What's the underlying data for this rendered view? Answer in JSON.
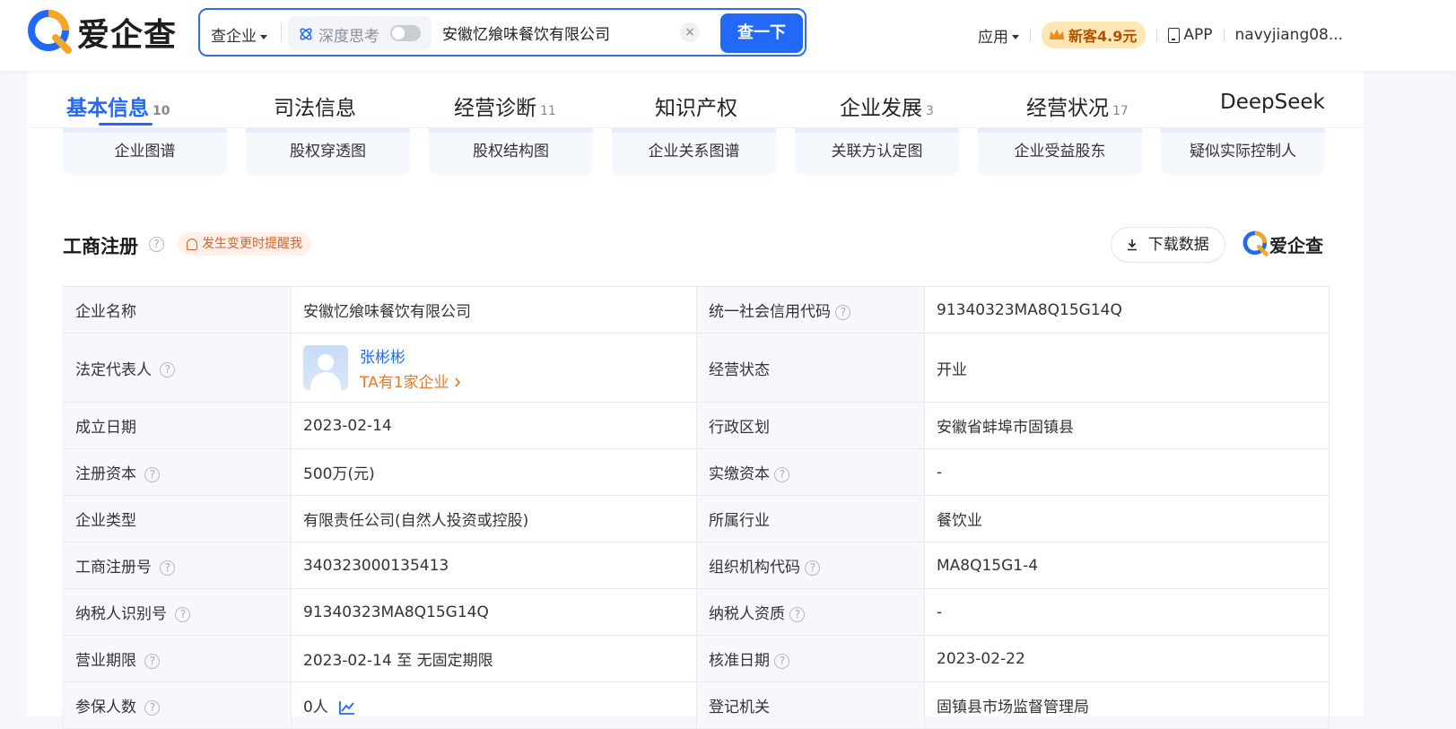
{
  "header": {
    "logo_text": "爱企查",
    "search_type": "查企业",
    "deep_think_label": "深度思考",
    "search_value": "安徽忆飨味餐饮有限公司",
    "clear_label": "×",
    "search_button": "查一下",
    "apps_label": "应用",
    "promo_label": "新客4.9元",
    "app_label": "APP",
    "username": "navyjiang08..."
  },
  "tabs": [
    {
      "label": "基本信息",
      "count": "10"
    },
    {
      "label": "司法信息",
      "count": ""
    },
    {
      "label": "经营诊断",
      "count": "11"
    },
    {
      "label": "知识产权",
      "count": ""
    },
    {
      "label": "企业发展",
      "count": "3"
    },
    {
      "label": "经营状况",
      "count": "17"
    },
    {
      "label": "DeepSeek",
      "count": ""
    }
  ],
  "graphs": [
    "企业图谱",
    "股权穿透图",
    "股权结构图",
    "企业关系图谱",
    "关联方认定图",
    "企业受益股东",
    "疑似实际控制人"
  ],
  "section": {
    "title": "工商注册",
    "help": "?",
    "remind": "发生变更时提醒我",
    "download": "下载数据",
    "watermark": "爱企查"
  },
  "legal_rep": {
    "name": "张彬彬",
    "link": "TA有1家企业"
  },
  "rows": [
    {
      "l1": "企业名称",
      "v1": "安徽忆飨味餐饮有限公司",
      "l2": "统一社会信用代码",
      "v2": "91340323MA8Q15G14Q"
    },
    {
      "l1": "法定代表人",
      "v1": "",
      "l2": "经营状态",
      "v2": "开业"
    },
    {
      "l1": "成立日期",
      "v1": "2023-02-14",
      "l2": "行政区划",
      "v2": "安徽省蚌埠市固镇县"
    },
    {
      "l1": "注册资本",
      "v1": "500万(元)",
      "l2": "实缴资本",
      "v2": "-"
    },
    {
      "l1": "企业类型",
      "v1": "有限责任公司(自然人投资或控股)",
      "l2": "所属行业",
      "v2": "餐饮业"
    },
    {
      "l1": "工商注册号",
      "v1": "340323000135413",
      "l2": "组织机构代码",
      "v2": "MA8Q15G1-4"
    },
    {
      "l1": "纳税人识别号",
      "v1": "91340323MA8Q15G14Q",
      "l2": "纳税人资质",
      "v2": "-"
    },
    {
      "l1": "营业期限",
      "v1": "2023-02-14 至 无固定期限",
      "l2": "核准日期",
      "v2": "2023-02-22"
    },
    {
      "l1": "参保人数",
      "v1": "0人",
      "l2": "登记机关",
      "v2": "固镇县市场监督管理局"
    }
  ],
  "colors": {
    "accent": "#2169f6",
    "orange": "#e67a2e"
  },
  "icons": [
    "logo-q-icon",
    "deepthink-icon",
    "crown-icon",
    "phone-icon",
    "help-icon",
    "bell-icon",
    "download-icon",
    "trend-chart-icon",
    "chevron-right-icon"
  ]
}
